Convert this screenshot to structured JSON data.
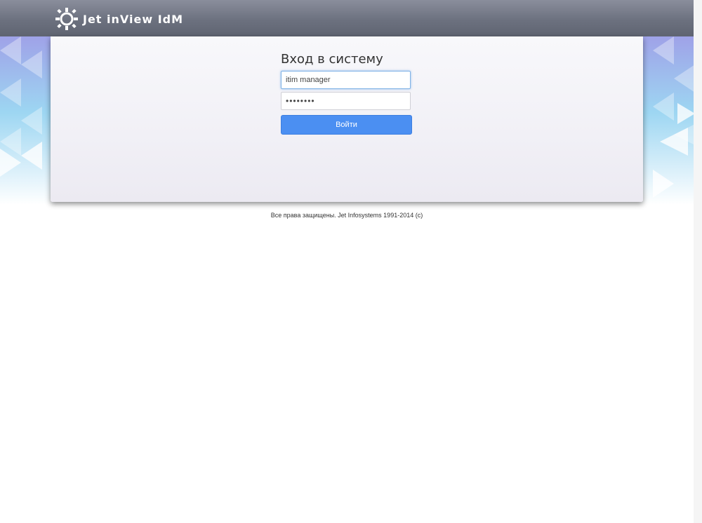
{
  "header": {
    "brand_text": "Jet inView IdM",
    "logo_icon": "jet-sun-logo-icon"
  },
  "login": {
    "title": "Вход в систему",
    "username_value": "itim manager",
    "password_value": "password",
    "submit_label": "Войти"
  },
  "footer": {
    "copyright": "Все права защищены. Jet Infosystems 1991-2014 (c)"
  },
  "colors": {
    "topbar": "#6c717f",
    "accent": "#4b8ff2",
    "panel": "#f1f0f6"
  }
}
